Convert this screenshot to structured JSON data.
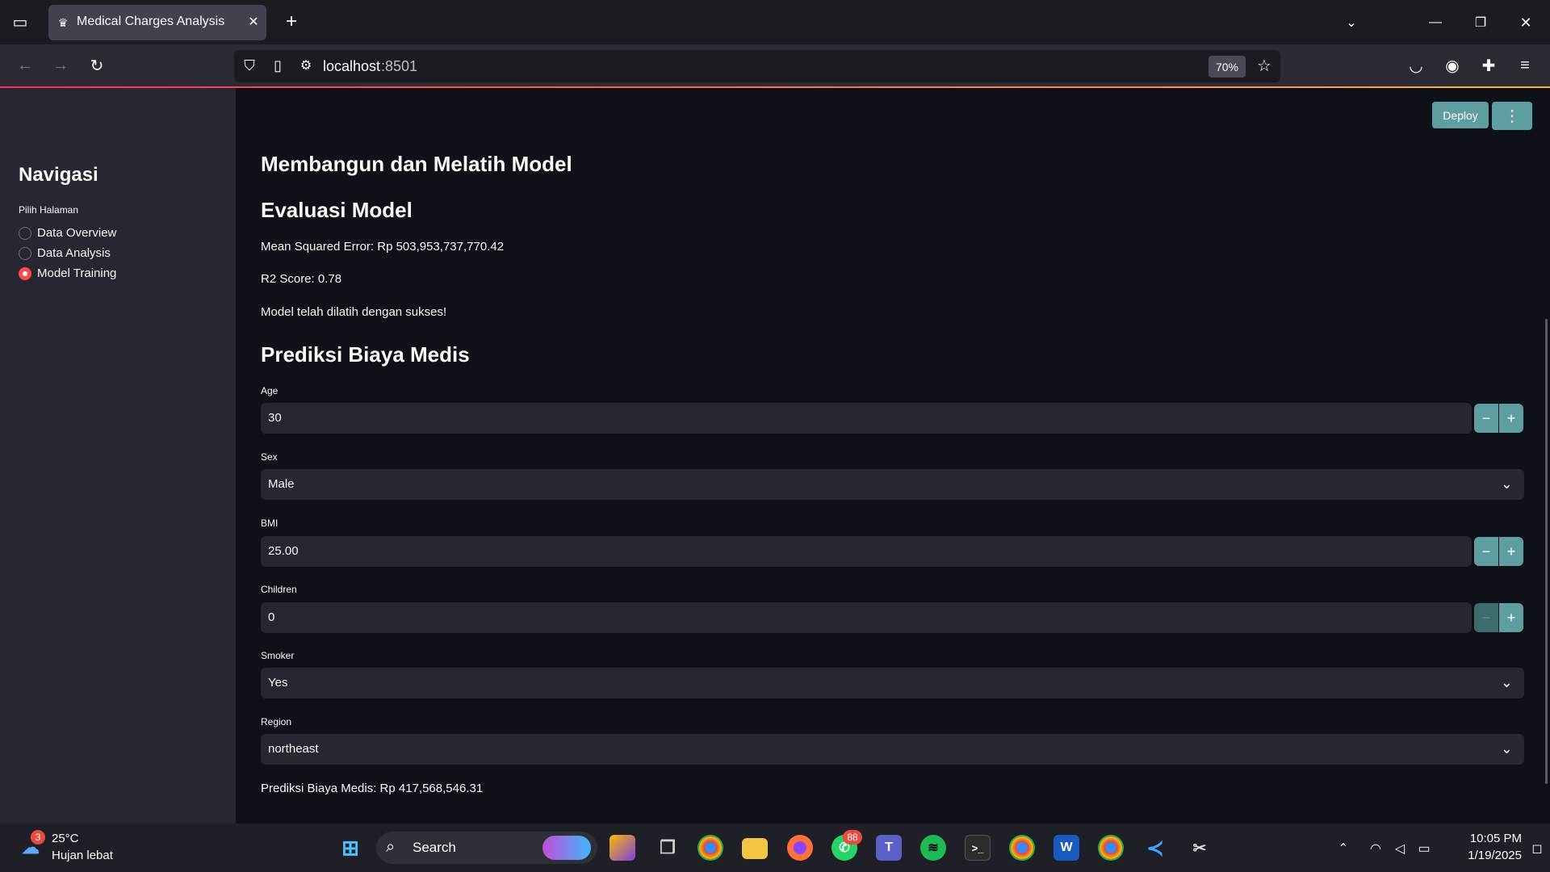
{
  "browser": {
    "tab_title": "Medical Charges Analysis",
    "url_host": "localhost",
    "url_port": ":8501",
    "zoom": "70%"
  },
  "sidebar": {
    "title": "Navigasi",
    "radio_label": "Pilih Halaman",
    "items": [
      {
        "label": "Data Overview",
        "selected": false
      },
      {
        "label": "Data Analysis",
        "selected": false
      },
      {
        "label": "Model Training",
        "selected": true
      }
    ]
  },
  "header": {
    "deploy_label": "Deploy",
    "menu_icon": "more-vertical-icon"
  },
  "main": {
    "title": "Membangun dan Melatih Model",
    "eval_title": "Evaluasi Model",
    "mse_text": "Mean Squared Error: Rp 503,953,737,770.42",
    "r2_text": "R2 Score: 0.78",
    "success_text": "Model telah dilatih dengan sukses!",
    "predict_title": "Prediksi Biaya Medis",
    "fields": {
      "age": {
        "label": "Age",
        "value": "30"
      },
      "sex": {
        "label": "Sex",
        "value": "Male"
      },
      "bmi": {
        "label": "BMI",
        "value": "25.00"
      },
      "children": {
        "label": "Children",
        "value": "0"
      },
      "smoker": {
        "label": "Smoker",
        "value": "Yes"
      },
      "region": {
        "label": "Region",
        "value": "northeast"
      }
    },
    "result_text": "Prediksi Biaya Medis: Rp 417,568,546.31"
  },
  "taskbar": {
    "weather_temp": "25°C",
    "weather_desc": "Hujan lebat",
    "weather_badge": "3",
    "search_label": "Search",
    "whatsapp_badge": "88",
    "time": "10:05 PM",
    "date": "1/19/2025"
  },
  "colors": {
    "accent": "#ff4b4b",
    "button": "#5f9ea0",
    "bg": "#0e1117",
    "sidebar": "#262730"
  }
}
